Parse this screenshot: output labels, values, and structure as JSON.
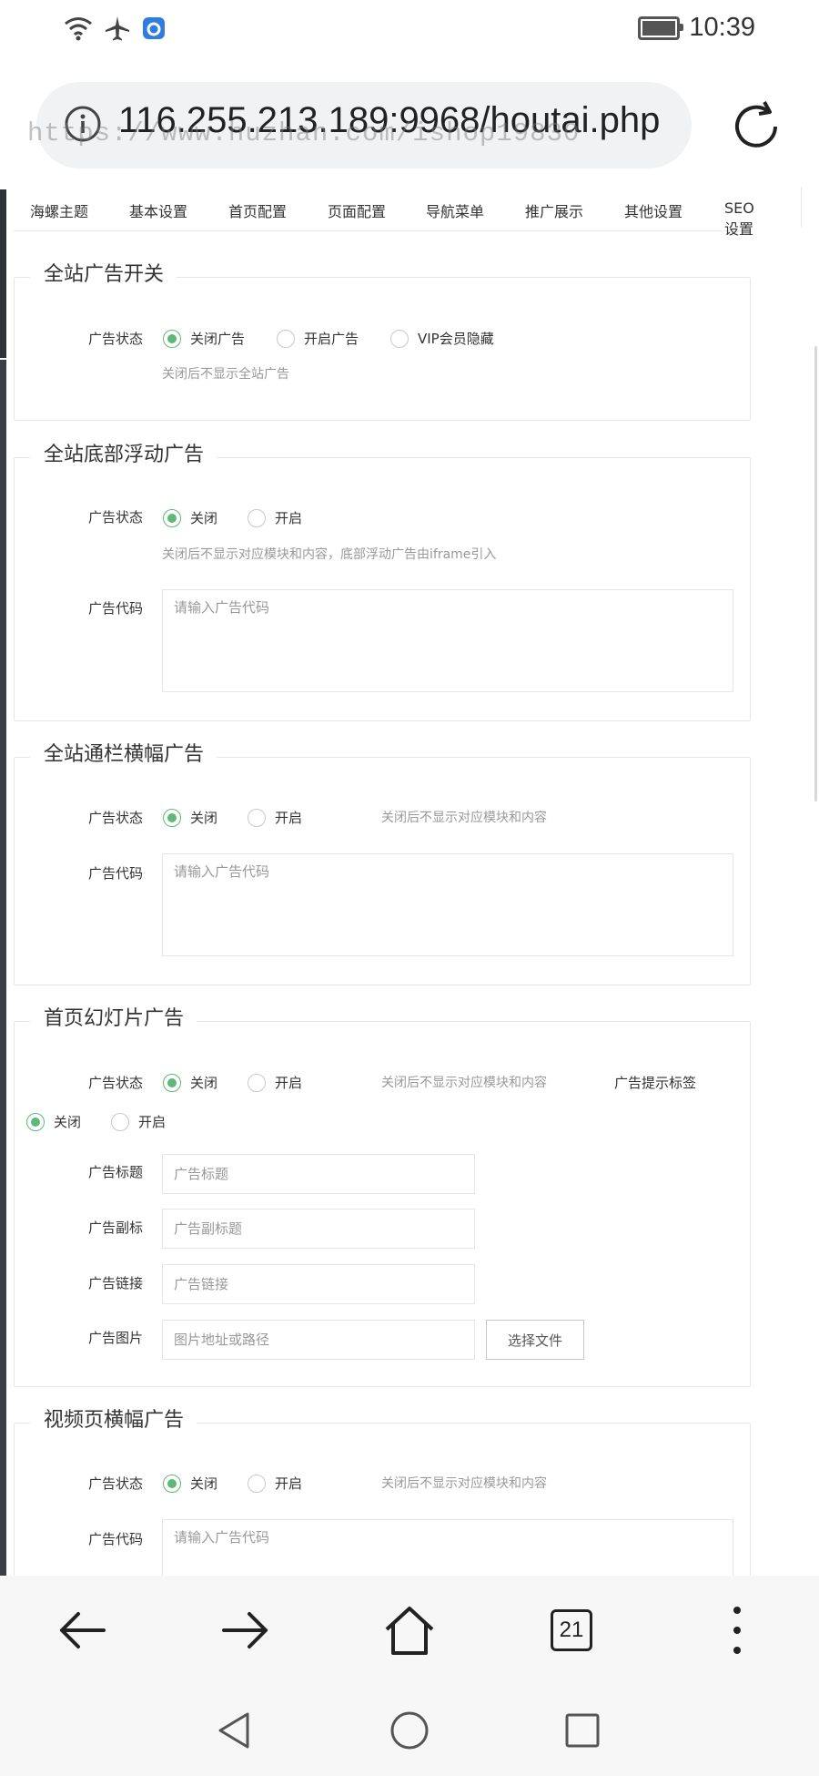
{
  "status_bar": {
    "time": "10:39"
  },
  "browser": {
    "url": "116.255.213.189:9968/houtai.php",
    "watermark": "https://www.huzhan.com/ishop19830",
    "tab_count": "21"
  },
  "tabs": [
    "海螺主题",
    "基本设置",
    "首页配置",
    "页面配置",
    "导航菜单",
    "推广展示",
    "其他设置",
    "SEO设置"
  ],
  "sections": {
    "site_ad": {
      "title": "全站广告开关",
      "status_label": "广告状态",
      "options": [
        "关闭广告",
        "开启广告",
        "VIP会员隐藏"
      ],
      "hint": "关闭后不显示全站广告"
    },
    "footer_float": {
      "title": "全站底部浮动广告",
      "status_label": "广告状态",
      "options": [
        "关闭",
        "开启"
      ],
      "hint": "关闭后不显示对应模块和内容，底部浮动广告由iframe引入",
      "code_label": "广告代码",
      "code_placeholder": "请输入广告代码"
    },
    "banner": {
      "title": "全站通栏横幅广告",
      "status_label": "广告状态",
      "options": [
        "关闭",
        "开启"
      ],
      "hint": "关闭后不显示对应模块和内容",
      "code_label": "广告代码",
      "code_placeholder": "请输入广告代码"
    },
    "slideshow": {
      "title": "首页幻灯片广告",
      "status_label": "广告状态",
      "options": [
        "关闭",
        "开启"
      ],
      "hint": "关闭后不显示对应模块和内容",
      "tip_label": "广告提示标签",
      "tip_options": [
        "关闭",
        "开启"
      ],
      "title_label": "广告标题",
      "title_placeholder": "广告标题",
      "subtitle_label": "广告副标",
      "subtitle_placeholder": "广告副标题",
      "link_label": "广告链接",
      "link_placeholder": "广告链接",
      "image_label": "广告图片",
      "image_placeholder": "图片地址或路径",
      "file_button": "选择文件"
    },
    "video_banner": {
      "title": "视频页横幅广告",
      "status_label": "广告状态",
      "options": [
        "关闭",
        "开启"
      ],
      "hint": "关闭后不显示对应模块和内容",
      "code_label": "广告代码",
      "code_placeholder": "请输入广告代码"
    }
  },
  "colors": {
    "accent": "#5fb878",
    "border": "#e6e6e6",
    "hint": "#999999"
  }
}
